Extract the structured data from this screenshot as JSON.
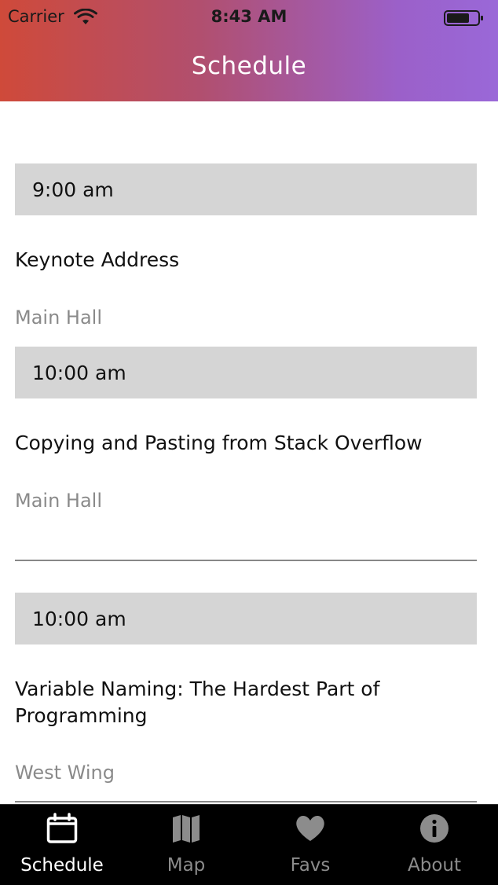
{
  "status_bar": {
    "carrier": "Carrier",
    "time": "8:43 AM"
  },
  "header": {
    "title": "Schedule"
  },
  "sessions": [
    {
      "time": "9:00 am",
      "title": "Keynote Address",
      "room": "Main Hall"
    },
    {
      "time": "10:00 am",
      "title": "Copying and Pasting from Stack Overflow",
      "room": "Main Hall"
    },
    {
      "time": "10:00 am",
      "title": "Variable Naming: The Hardest Part of Programming",
      "room": "West Wing"
    }
  ],
  "tabs": [
    {
      "label": "Schedule",
      "icon": "calendar-icon",
      "active": true
    },
    {
      "label": "Map",
      "icon": "map-icon",
      "active": false
    },
    {
      "label": "Favs",
      "icon": "heart-icon",
      "active": false
    },
    {
      "label": "About",
      "icon": "info-icon",
      "active": false
    }
  ],
  "colors": {
    "header_gradient_start": "#cf4a3a",
    "header_gradient_end": "#9a68d8",
    "time_band": "#d5d5d5",
    "room_text": "#8a8a8a",
    "tab_active": "#ffffff",
    "tab_inactive": "#8c8c8c"
  }
}
